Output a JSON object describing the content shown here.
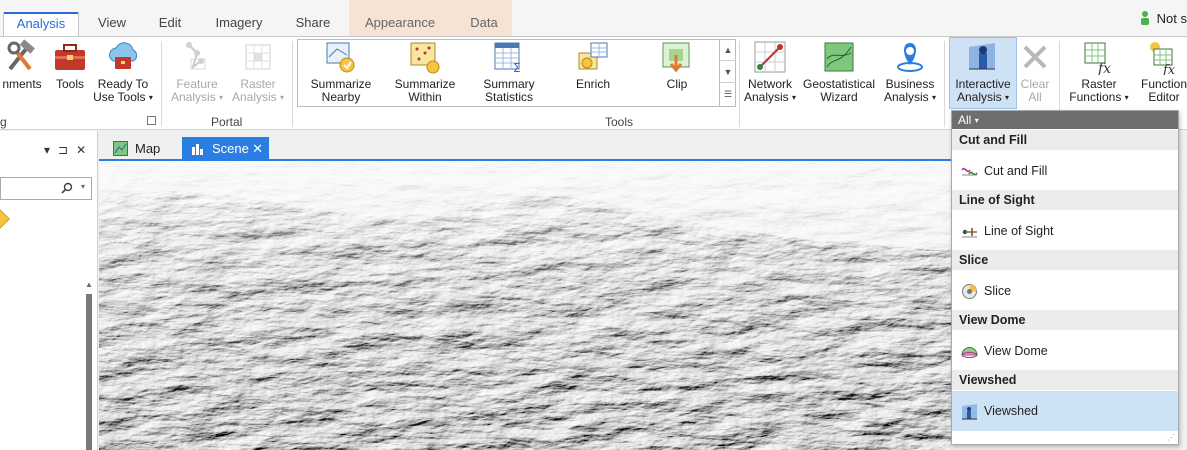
{
  "tabs": [
    {
      "label": "Analysis",
      "active": true
    },
    {
      "label": "View"
    },
    {
      "label": "Edit"
    },
    {
      "label": "Imagery"
    },
    {
      "label": "Share"
    },
    {
      "label": "Appearance",
      "contextual": true
    },
    {
      "label": "Data",
      "contextual": true
    }
  ],
  "account": {
    "status": "Not s",
    "icon": "person-icon"
  },
  "ribbon": {
    "geoprocessing": {
      "environments": {
        "label": "nments",
        "icon": "hammer-wrench-icon"
      },
      "tools": {
        "label": "Tools",
        "icon": "toolbox-icon"
      },
      "ready_to_use": {
        "line1": "Ready To",
        "line2": "Use Tools",
        "icon": "cloud-toolbox-icon"
      },
      "group_label": "g"
    },
    "portal": {
      "feature_analysis": {
        "line1": "Feature",
        "line2": "Analysis",
        "icon": "feature-analysis-icon",
        "disabled": true
      },
      "raster_analysis": {
        "line1": "Raster",
        "line2": "Analysis",
        "icon": "raster-analysis-icon",
        "disabled": true
      },
      "group_label": "Portal"
    },
    "tools": {
      "items": [
        {
          "line1": "Summarize",
          "line2": "Nearby",
          "icon": "summarize-nearby-icon"
        },
        {
          "line1": "Summarize",
          "line2": "Within",
          "icon": "summarize-within-icon"
        },
        {
          "line1": "Summary",
          "line2": "Statistics",
          "icon": "summary-statistics-icon"
        },
        {
          "line1": "Enrich",
          "line2": "",
          "icon": "enrich-icon"
        },
        {
          "line1": "Clip",
          "line2": "",
          "icon": "clip-icon"
        }
      ],
      "group_label": "Tools"
    },
    "network_analysis": {
      "line1": "Network",
      "line2": "Analysis",
      "icon": "network-analysis-icon"
    },
    "geostatistical_wizard": {
      "line1": "Geostatistical",
      "line2": "Wizard",
      "icon": "geostatistical-wizard-icon"
    },
    "business_analysis": {
      "line1": "Business",
      "line2": "Analysis",
      "icon": "business-analysis-icon"
    },
    "interactive_analysis": {
      "line1": "Interactive",
      "line2": "Analysis",
      "icon": "interactive-analysis-icon"
    },
    "clear_all": {
      "line1": "Clear",
      "line2": "All",
      "icon": "clear-x-icon",
      "disabled": true
    },
    "raster_functions": {
      "line1": "Raster",
      "line2": "Functions",
      "icon": "raster-functions-icon"
    },
    "function_editor": {
      "line1": "Function",
      "line2": "Editor",
      "icon": "function-editor-icon"
    }
  },
  "left_pane": {
    "controls": [
      "▾",
      "⊐",
      "✕"
    ],
    "search_placeholder": ""
  },
  "view_tabs": [
    {
      "label": "Map",
      "icon": "map-icon",
      "active": false
    },
    {
      "label": "Scene",
      "icon": "scene-icon",
      "active": true,
      "close": "✕"
    }
  ],
  "dropdown": {
    "filter_label": "All",
    "sections": [
      {
        "header": "Cut and Fill",
        "items": [
          {
            "label": "Cut and Fill",
            "icon": "cut-and-fill-icon"
          }
        ]
      },
      {
        "header": "Line of Sight",
        "items": [
          {
            "label": "Line of Sight",
            "icon": "line-of-sight-icon"
          }
        ]
      },
      {
        "header": "Slice",
        "items": [
          {
            "label": "Slice",
            "icon": "slice-icon"
          }
        ]
      },
      {
        "header": "View Dome",
        "items": [
          {
            "label": "View Dome",
            "icon": "view-dome-icon"
          }
        ]
      },
      {
        "header": "Viewshed",
        "items": [
          {
            "label": "Viewshed",
            "icon": "viewshed-icon",
            "selected": true
          }
        ]
      }
    ]
  },
  "colors": {
    "accent": "#2a7de1",
    "selected": "#cde2f5",
    "contextual_tab": "#f6e3d6"
  }
}
